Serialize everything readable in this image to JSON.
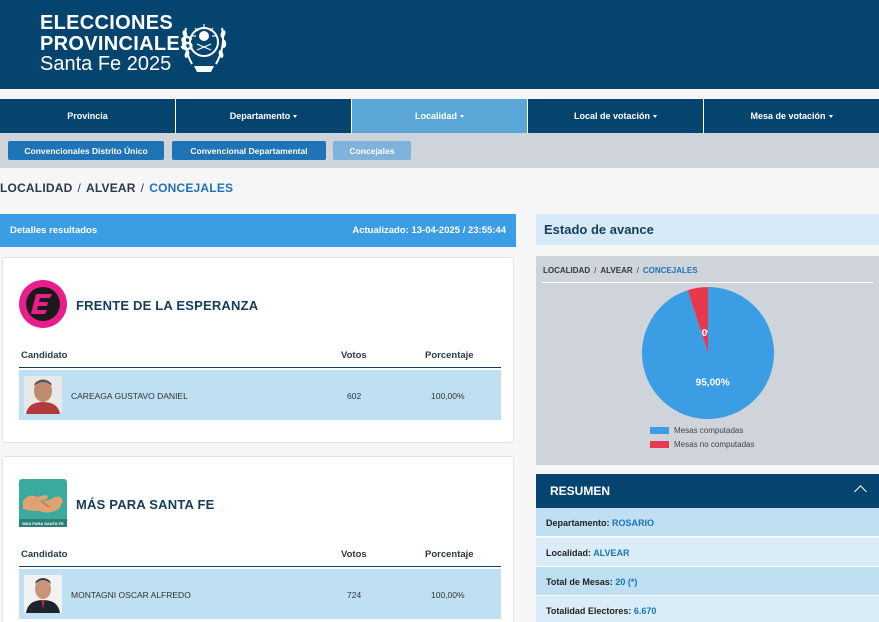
{
  "header": {
    "line1": "ELECCIONES",
    "line2": "PROVINCIALES",
    "line3": "Santa Fe 2025"
  },
  "nav": {
    "items": [
      {
        "label": "Provincia",
        "dropdown": false,
        "active": false
      },
      {
        "label": "Departamento",
        "dropdown": true,
        "active": false
      },
      {
        "label": "Localidad",
        "dropdown": true,
        "active": true
      },
      {
        "label": "Local de votación",
        "dropdown": true,
        "active": false
      },
      {
        "label": "Mesa de votación",
        "dropdown": true,
        "active": false
      }
    ]
  },
  "subnav": {
    "items": [
      {
        "label": "Convencionales Distrito Único",
        "active": true
      },
      {
        "label": "Convencional Departamental",
        "active": true
      },
      {
        "label": "Concejales",
        "active": false
      }
    ]
  },
  "breadcrumb": [
    "LOCALIDAD",
    "ALVEAR",
    "CONCEJALES"
  ],
  "results": {
    "title": "Detalles resultados",
    "updated": "Actualizado: 13-04-2025 / 23:55:44",
    "columns": [
      "Candidato",
      "Votos",
      "Porcentaje"
    ],
    "parties": [
      {
        "name": "FRENTE DE LA ESPERANZA",
        "logo_icon": "frente-esperanza-logo",
        "candidate": "CAREAGA GUSTAVO DANIEL",
        "votes": "602",
        "percent": "100,00%"
      },
      {
        "name": "MÁS PARA SANTA FE",
        "logo_icon": "mas-para-santa-fe-logo",
        "logo_text": "MÁS PARA SANTA FE",
        "candidate": "MONTAGNI OSCAR ALFREDO",
        "votes": "724",
        "percent": "100,00%"
      }
    ]
  },
  "progress": {
    "title": "Estado de avance",
    "breadcrumb": [
      "LOCALIDAD",
      "ALVEAR",
      "CONCEJALES"
    ],
    "chart_data": {
      "type": "pie",
      "labels": [
        "Mesas computadas",
        "Mesas no computadas"
      ],
      "values": [
        95.0,
        5.0
      ],
      "value_labels": [
        "95,00%",
        "5,00%"
      ],
      "colors": [
        "#3b9ee4",
        "#e8384f"
      ],
      "legend": "bottom"
    }
  },
  "resumen": {
    "title": "RESUMEN",
    "rows": [
      {
        "label": "Departamento:",
        "value": "ROSARIO"
      },
      {
        "label": "Localidad:",
        "value": "ALVEAR"
      },
      {
        "label": "Total de Mesas:",
        "value": "20 (*)"
      },
      {
        "label": "Totalidad Electores:",
        "value": "6.670"
      }
    ]
  },
  "colors": {
    "header": "#05446e",
    "accent": "#3b9ee4",
    "active_nav": "#5aa6d6",
    "row": "#bfe0f2"
  }
}
